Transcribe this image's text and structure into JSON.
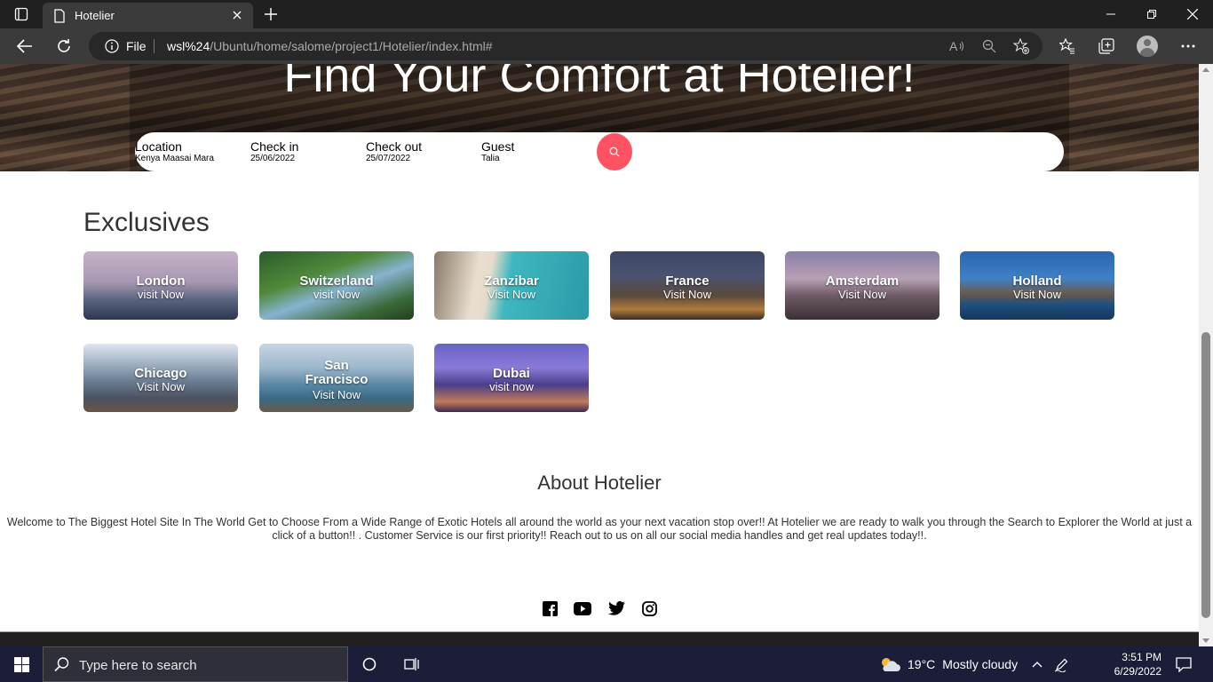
{
  "browser": {
    "tab_title": "Hotelier",
    "url_scheme_label": "File",
    "url_host": "wsl%24",
    "url_path": "/Ubuntu/home/salome/project1/Hotelier/index.html#"
  },
  "hero": {
    "title": "Find Your Comfort at Hotelier!",
    "search": {
      "location_label": "Location",
      "location_value": "Kenya Maasai Mara",
      "checkin_label": "Check in",
      "checkin_value": "25/06/2022",
      "checkout_label": "Check out",
      "checkout_value": "25/07/2022",
      "guest_label": "Guest",
      "guest_value": "Talia"
    }
  },
  "exclusives": {
    "title": "Exclusives",
    "cards": [
      {
        "name": "London",
        "cta": "visit Now"
      },
      {
        "name": "Switzerland",
        "cta": "visit Now"
      },
      {
        "name": "Zanzibar",
        "cta": "Visit Now"
      },
      {
        "name": "France",
        "cta": "Visit Now"
      },
      {
        "name": "Amsterdam",
        "cta": "Visit Now"
      },
      {
        "name": "Holland",
        "cta": "Visit Now"
      },
      {
        "name": "Chicago",
        "cta": "Visit Now"
      },
      {
        "name": "San Francisco",
        "cta": "Visit Now"
      },
      {
        "name": "Dubai",
        "cta": "visit now"
      }
    ]
  },
  "about": {
    "title": "About Hotelier",
    "text": "Welcome to The Biggest Hotel Site In The World Get to Choose From a Wide Range of Exotic Hotels all around the world as your next vacation stop over!! At Hotelier we are ready to walk you through the Search to Explorer the World at just a click of a button!! . Customer Service is our first priority!! Reach out to us on all our social media handles and get real updates today!!."
  },
  "social_icons": [
    "facebook-icon",
    "youtube-icon",
    "twitter-icon",
    "instagram-icon"
  ],
  "taskbar": {
    "search_placeholder": "Type here to search",
    "temperature": "19°C",
    "weather": "Mostly cloudy",
    "time": "3:51 PM",
    "date": "6/29/2022"
  },
  "colors": {
    "accent": "#ff5363",
    "chrome_dark": "#202020",
    "chrome_mid": "#3b3b3b",
    "taskbar": "#1c1d38"
  }
}
